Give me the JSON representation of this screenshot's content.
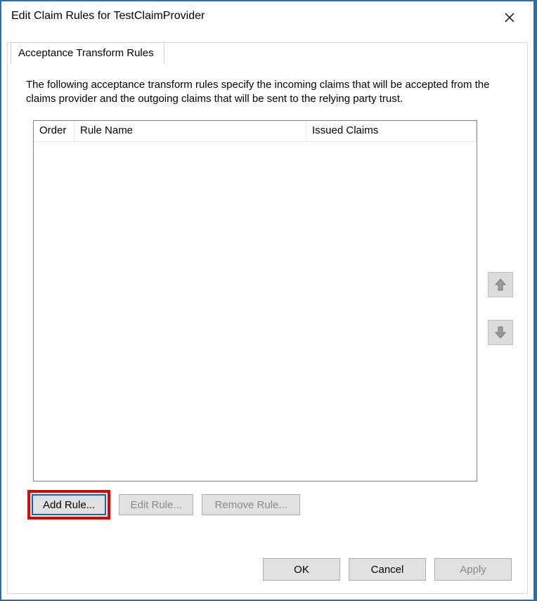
{
  "window": {
    "title": "Edit Claim Rules for TestClaimProvider"
  },
  "tabs": {
    "active": "Acceptance Transform Rules"
  },
  "description": "The following acceptance transform rules specify the incoming claims that will be accepted from the claims provider and the outgoing claims that will be sent to the relying party trust.",
  "table": {
    "columns": {
      "order": "Order",
      "ruleName": "Rule Name",
      "issuedClaims": "Issued Claims"
    },
    "rows": []
  },
  "buttons": {
    "addRule": "Add Rule...",
    "editRule": "Edit Rule...",
    "removeRule": "Remove Rule...",
    "ok": "OK",
    "cancel": "Cancel",
    "apply": "Apply"
  }
}
